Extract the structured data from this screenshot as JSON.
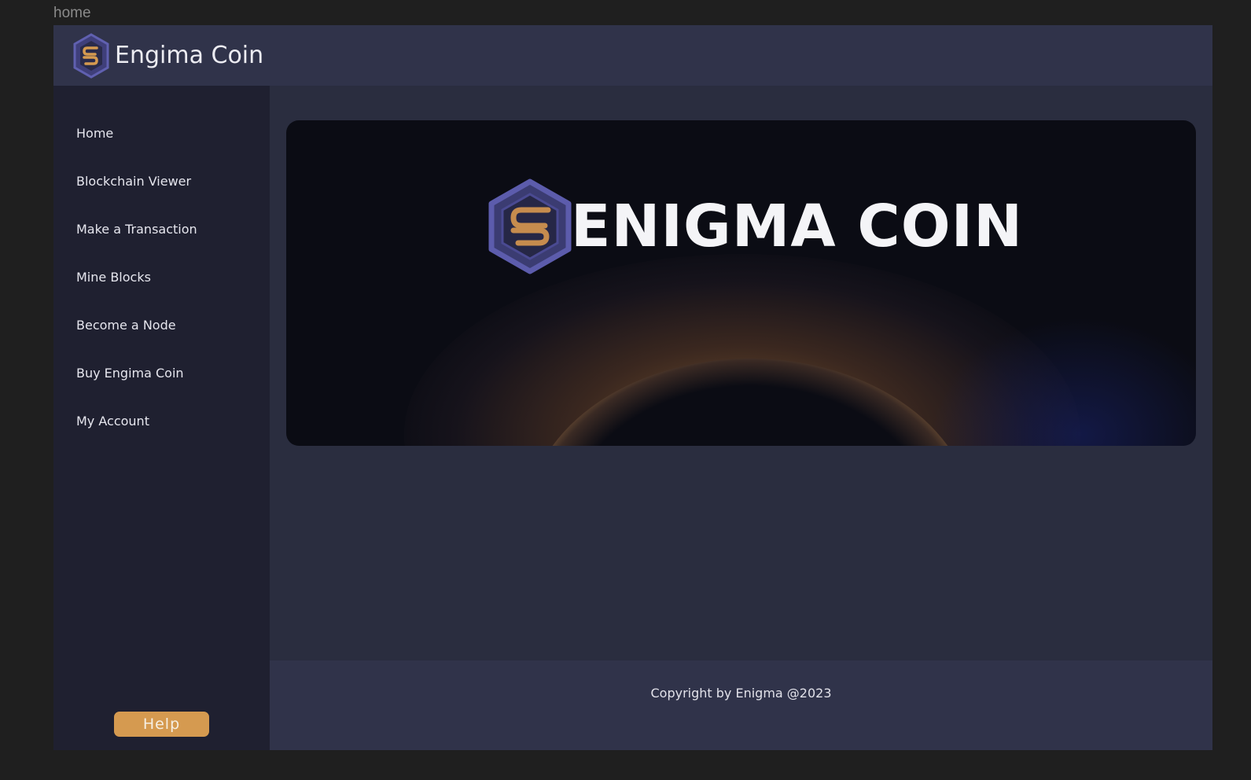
{
  "frame": {
    "label": "home"
  },
  "header": {
    "brand_name": "Engima Coin",
    "logo_icon": "enigma-hexagon-logo"
  },
  "sidebar": {
    "items": [
      {
        "label": "Home"
      },
      {
        "label": "Blockchain Viewer"
      },
      {
        "label": "Make a Transaction"
      },
      {
        "label": "Mine Blocks"
      },
      {
        "label": "Become a Node"
      },
      {
        "label": "Buy Engima Coin"
      },
      {
        "label": "My Account"
      }
    ],
    "help_label": "Help"
  },
  "hero": {
    "title": "ENIGMA COIN"
  },
  "footer": {
    "copyright": "Copyright by Enigma @2023"
  },
  "colors": {
    "accent": "#d59a50",
    "logo_purple": "#5a5aa8",
    "background": "#1f1f1f",
    "app_bg": "#2a2d3f",
    "header_bg": "#30334a",
    "sidebar_bg": "#1f2030"
  }
}
